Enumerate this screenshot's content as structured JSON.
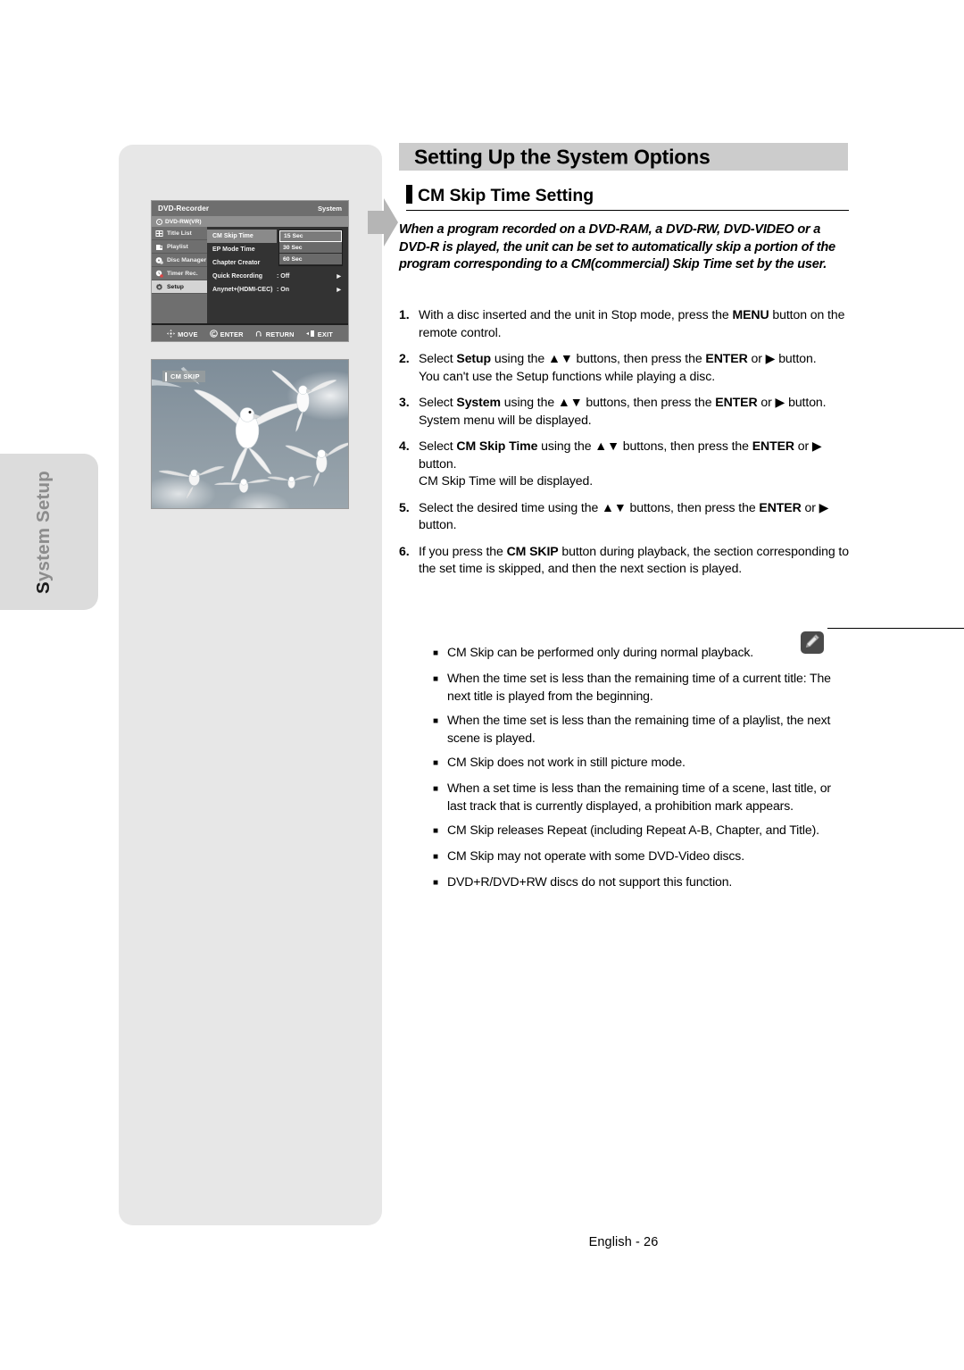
{
  "page": {
    "title": "Setting Up the System Options",
    "section_heading": "CM Skip Time Setting",
    "lead_paragraph": "When a program recorded on a DVD-RAM, a DVD-RW, DVD-VIDEO or a DVD-R is played, the unit can be set to automatically skip a portion of the program corresponding to a CM(commercial) Skip Time set by the user.",
    "footer": "English - 26"
  },
  "sidebar_tab": {
    "label_cap": "S",
    "label_rest": "ystem Setup",
    "label_full": "System Setup"
  },
  "osd_menu": {
    "title": "DVD-Recorder",
    "title_right": "System",
    "disc_label": "DVD-RW(VR)",
    "sidebar_items": [
      {
        "label": "Title List",
        "icon": "film-icon",
        "selected": false
      },
      {
        "label": "Playlist",
        "icon": "playlist-icon",
        "selected": false
      },
      {
        "label": "Disc Manager",
        "icon": "disc-icon",
        "selected": false
      },
      {
        "label": "Timer Rec.",
        "icon": "clock-record-icon",
        "selected": false
      },
      {
        "label": "Setup",
        "icon": "gear-icon",
        "selected": true
      }
    ],
    "options": [
      {
        "name": "CM Skip Time",
        "value": "",
        "arrow": "",
        "highlighted": true
      },
      {
        "name": "EP Mode Time",
        "value": "",
        "arrow": "",
        "highlighted": false
      },
      {
        "name": "Chapter Creator",
        "value": "",
        "arrow": "",
        "highlighted": false
      },
      {
        "name": "Quick Recording",
        "value": ": Off",
        "arrow": "▶",
        "highlighted": false
      },
      {
        "name": "Anynet+(HDMI-CEC)",
        "value": ": On",
        "arrow": "▶",
        "highlighted": false
      }
    ],
    "dropdown": [
      {
        "label": "15 Sec",
        "selected": true
      },
      {
        "label": "30 Sec",
        "selected": false
      },
      {
        "label": "60 Sec",
        "selected": false
      }
    ],
    "footer_buttons": [
      {
        "label": "MOVE",
        "icon": "dpad-icon"
      },
      {
        "label": "ENTER",
        "icon": "enter-icon"
      },
      {
        "label": "RETURN",
        "icon": "return-icon"
      },
      {
        "label": "EXIT",
        "icon": "exit-icon"
      }
    ]
  },
  "tv_screenshot": {
    "osd_label": "CM SKIP",
    "description": "seagulls-flying-photo"
  },
  "steps": [
    {
      "num": "1.",
      "parts": [
        {
          "t": "With a disc inserted and the unit in Stop mode, press the ",
          "b": false
        },
        {
          "t": "MENU",
          "b": true
        },
        {
          "t": " button on the remote control.",
          "b": false
        }
      ],
      "sub": ""
    },
    {
      "num": "2.",
      "parts": [
        {
          "t": "Select ",
          "b": false
        },
        {
          "t": "Setup",
          "b": true
        },
        {
          "t": " using the ▲▼ buttons, then press the ",
          "b": false
        },
        {
          "t": "ENTER",
          "b": true
        },
        {
          "t": " or ▶ button.",
          "b": false
        }
      ],
      "sub": "You can't use the Setup functions while playing a disc."
    },
    {
      "num": "3.",
      "parts": [
        {
          "t": "Select ",
          "b": false
        },
        {
          "t": "System",
          "b": true
        },
        {
          "t": " using the ▲▼ buttons, then press the ",
          "b": false
        },
        {
          "t": "ENTER",
          "b": true
        },
        {
          "t": " or ▶ button.",
          "b": false
        }
      ],
      "sub": "System menu will be displayed."
    },
    {
      "num": "4.",
      "parts": [
        {
          "t": "Select ",
          "b": false
        },
        {
          "t": "CM Skip Time",
          "b": true
        },
        {
          "t": " using the ▲▼ buttons, then press the ",
          "b": false
        },
        {
          "t": "ENTER",
          "b": true
        },
        {
          "t": " or ▶ button.",
          "b": false
        }
      ],
      "sub": "CM Skip Time will be displayed."
    },
    {
      "num": "5.",
      "parts": [
        {
          "t": "Select the desired time using the ▲▼ buttons, then press the ",
          "b": false
        },
        {
          "t": "ENTER",
          "b": true
        },
        {
          "t": " or ▶ button.",
          "b": false
        }
      ],
      "sub": ""
    },
    {
      "num": "6.",
      "parts": [
        {
          "t": "If you press the ",
          "b": false
        },
        {
          "t": "CM SKIP",
          "b": true
        },
        {
          "t": " button during playback, the section corresponding to the set time is skipped, and then the next section is played.",
          "b": false
        }
      ],
      "sub": ""
    }
  ],
  "notes": {
    "icon": "note-pencil-icon",
    "bullet": "■",
    "items": [
      "CM Skip can be performed only during normal playback.",
      "When the time set is less than the remaining time of a current title: The next title is played from the beginning.",
      "When the time set is less than the remaining time of a playlist, the next scene is played.",
      "CM Skip does not work in still picture mode.",
      "When a set time is less than the remaining time of a scene, last title, or last track that is currently displayed, a prohibition mark appears.",
      "CM Skip releases Repeat (including Repeat A-B, Chapter, and Title).",
      "CM Skip may not operate with some DVD-Video discs.",
      "DVD+R/DVD+RW discs do not support this function."
    ]
  },
  "colors": {
    "panel_gray": "#e7e7e7",
    "tab_gray": "#dcdcdc",
    "title_bar_gray": "#cccccc",
    "arrow_gray": "#b5b5b5",
    "note_icon_dark": "#4a4a4a"
  }
}
